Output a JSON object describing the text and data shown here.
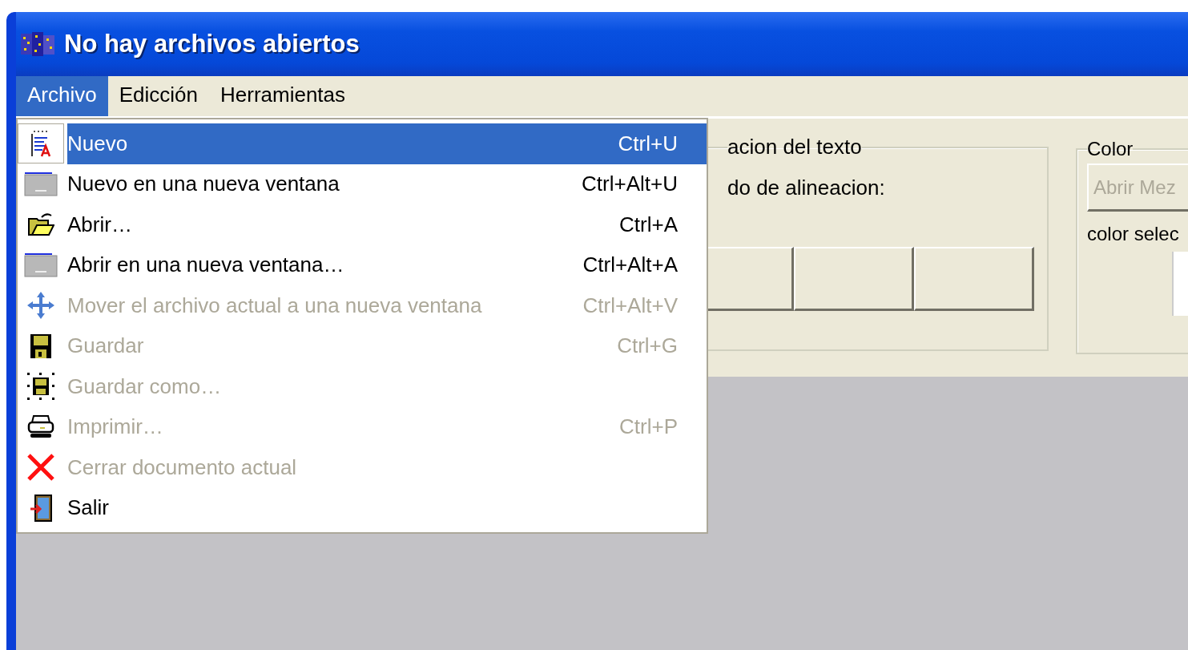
{
  "window": {
    "title": "No hay archivos abiertos"
  },
  "menu_bar": [
    {
      "label": "Archivo",
      "selected": true
    },
    {
      "label": "Edicción",
      "selected": false
    },
    {
      "label": "Herramientas",
      "selected": false
    }
  ],
  "file_menu": [
    {
      "label": "Nuevo",
      "shortcut": "Ctrl+U",
      "selected": true,
      "disabled": false
    },
    {
      "label": "Nuevo en una nueva ventana",
      "shortcut": "Ctrl+Alt+U",
      "selected": false,
      "disabled": false
    },
    {
      "label": "Abrir…",
      "shortcut": "Ctrl+A",
      "selected": false,
      "disabled": false
    },
    {
      "label": "Abrir en una nueva ventana…",
      "shortcut": "Ctrl+Alt+A",
      "selected": false,
      "disabled": false
    },
    {
      "label": "Mover el archivo actual a una nueva ventana",
      "shortcut": "Ctrl+Alt+V",
      "selected": false,
      "disabled": true
    },
    {
      "label": "Guardar",
      "shortcut": "Ctrl+G",
      "selected": false,
      "disabled": true
    },
    {
      "label": "Guardar como…",
      "selected": false,
      "disabled": true
    },
    {
      "label": "Imprimir…",
      "shortcut": "Ctrl+P",
      "selected": false,
      "disabled": true
    },
    {
      "label": "Cerrar documento actual",
      "selected": false,
      "disabled": true
    },
    {
      "label": "Salir",
      "selected": false,
      "disabled": false
    }
  ],
  "alignment_group": {
    "title": "acion del texto",
    "label": "do de alineacion:"
  },
  "color_group": {
    "title": "Color",
    "button": {
      "label": "Abrir Mez",
      "disabled": true
    },
    "label": "color selec"
  }
}
